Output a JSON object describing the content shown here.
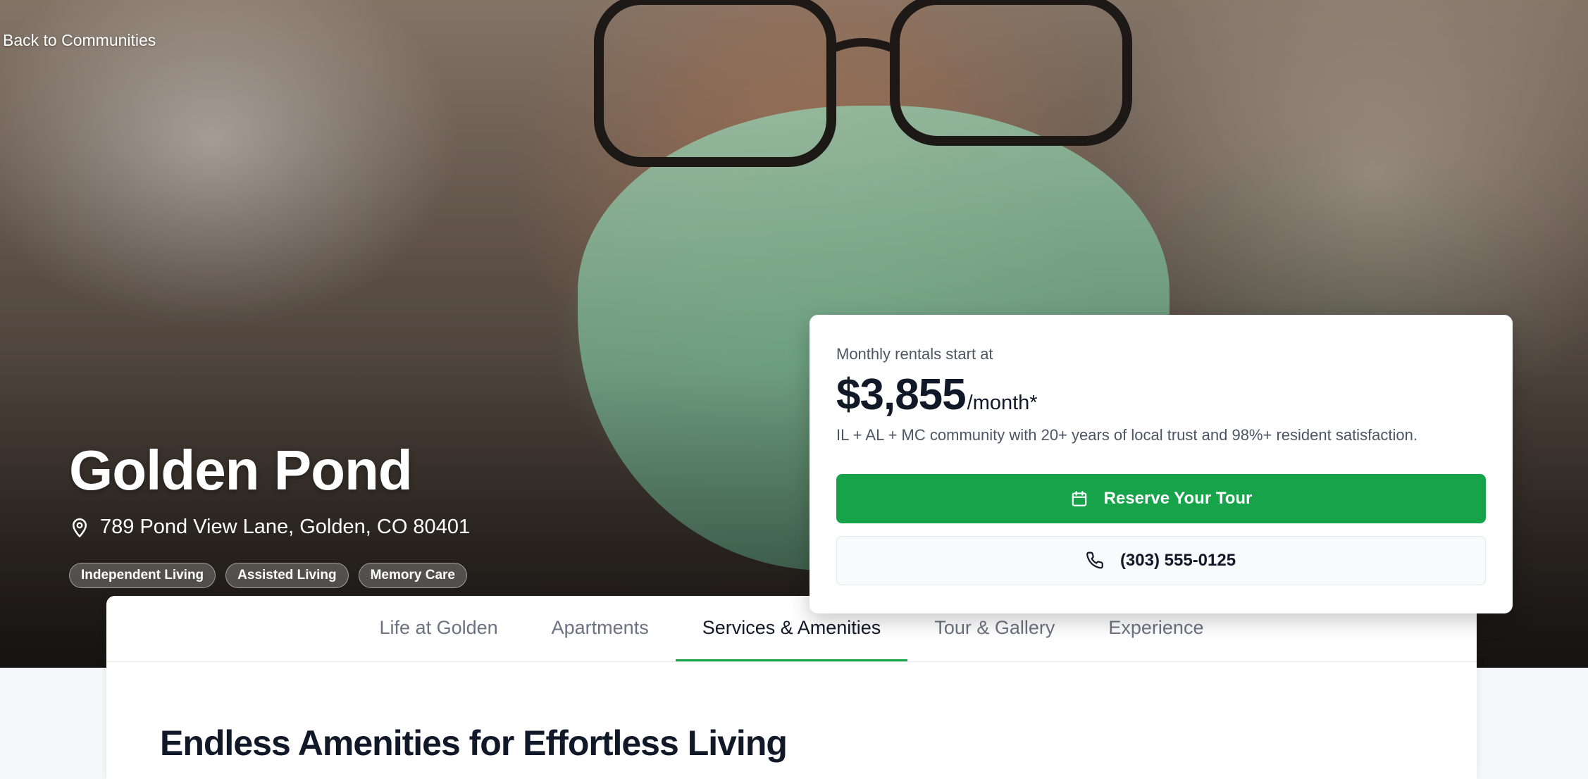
{
  "nav": {
    "back_label": "Back to Communities"
  },
  "hero": {
    "title": "Golden Pond",
    "address": "789 Pond View Lane, Golden, CO 80401",
    "tags": [
      "Independent Living",
      "Assisted Living",
      "Memory Care"
    ]
  },
  "pricing": {
    "lead": "Monthly rentals start at",
    "price": "$3,855",
    "per": "/month*",
    "description": "IL + AL + MC community with 20+ years of local trust and 98%+ resident satisfaction.",
    "tour_button": "Reserve Your Tour",
    "phone_button": "(303) 555-0125"
  },
  "tabs": [
    {
      "label": "Life at Golden",
      "active": false
    },
    {
      "label": "Apartments",
      "active": false
    },
    {
      "label": "Services & Amenities",
      "active": true
    },
    {
      "label": "Tour & Gallery",
      "active": false
    },
    {
      "label": "Experience",
      "active": false
    }
  ],
  "section": {
    "heading": "Endless Amenities for Effortless Living"
  },
  "colors": {
    "accent": "#16a34a",
    "text": "#111827",
    "muted": "#6b7280"
  },
  "icons": {
    "location": "map-pin-icon",
    "calendar": "calendar-icon",
    "phone": "phone-icon"
  }
}
